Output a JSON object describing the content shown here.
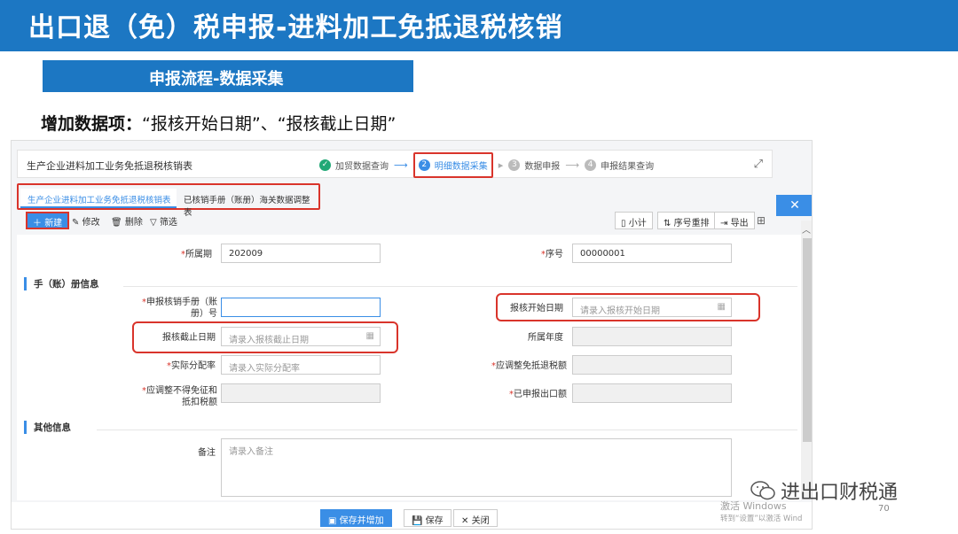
{
  "slide": {
    "title": "出口退（免）税申报-进料加工免抵退税核销",
    "section_tab": "申报流程-数据采集",
    "subtitle_bold": "增加数据项：",
    "subtitle_rest": "“报核开始日期”、“报核截止日期”",
    "page_number": "70",
    "brand": "进出口财税通",
    "watermark_line1": "激活 Windows",
    "watermark_line2": "转到“设置”以激活 Wind"
  },
  "app": {
    "header_title": "生产企业进料加工业务免抵退税核销表",
    "steps": [
      {
        "num": "✓",
        "label": "加贸数据查询"
      },
      {
        "num": "2",
        "label": "明细数据采集"
      },
      {
        "num": "3",
        "label": "数据申报"
      },
      {
        "num": "4",
        "label": "申报结果查询"
      }
    ],
    "tabs": [
      "生产企业进料加工业务免抵退税核销表",
      "已核销手册（账册）海关数据调整表"
    ],
    "toolbar": {
      "new": "新建",
      "edit": "修改",
      "delete": "删除",
      "filter": "筛选",
      "subtotal": "小计",
      "reorder": "序号重排",
      "export": "导出"
    },
    "form": {
      "period_label": "所属期",
      "period_value": "202009",
      "seq_label": "序号",
      "seq_value": "00000001",
      "section1": "手（账）册信息",
      "manual_label_1": "申报核销手册（账",
      "manual_label_2": "册）号",
      "manual_value": "",
      "start_date_label": "报核开始日期",
      "start_date_placeholder": "请录入报核开始日期",
      "end_date_label": "报核截止日期",
      "end_date_placeholder": "请录入报核截止日期",
      "year_label": "所属年度",
      "year_value": "",
      "ratio_label": "实际分配率",
      "ratio_placeholder": "请录入实际分配率",
      "adj_exempt_label": "应调整免抵退税额",
      "adj_exempt_value": "",
      "adj_no_exempt_label_1": "应调整不得免征和",
      "adj_no_exempt_label_2": "抵扣税额",
      "adj_no_exempt_value": "",
      "declared_export_label": "已申报出口额",
      "declared_export_value": "",
      "section2": "其他信息",
      "remark_label": "备注",
      "remark_placeholder": "请录入备注"
    },
    "bottom": {
      "save_and_add": "保存并增加",
      "save": "保存",
      "close": "关闭"
    }
  },
  "colors": {
    "brand_blue": "#1c77c3",
    "accent_blue": "#3a8ee6",
    "highlight_red": "#d9342b",
    "done_green": "#21a876"
  }
}
